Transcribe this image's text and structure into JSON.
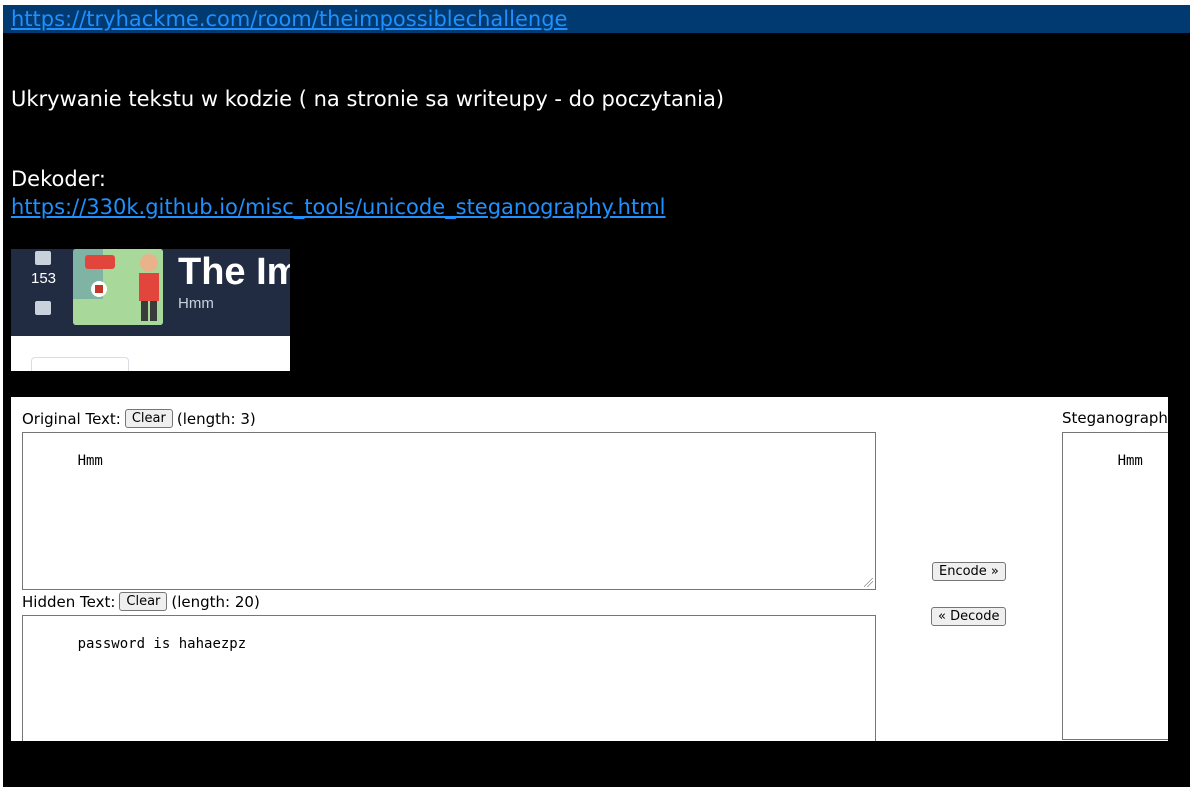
{
  "links": {
    "room_url": "https://tryhackme.com/room/theimpossiblechallenge",
    "decoder_url": "https://330k.github.io/misc_tools/unicode_steganography.html"
  },
  "notes": {
    "line1": "Ukrywanie tekstu w kodzie ( na stronie sa writeupy - do poczytania)",
    "decoder_label": "Dekoder:"
  },
  "room_card": {
    "vote_count": "153",
    "title": "The Im",
    "subtitle": "Hmm",
    "icons": [
      "thumbs-up-icon",
      "thumbs-down-icon"
    ]
  },
  "tool": {
    "original_label": "Original Text:",
    "original_clear": "Clear",
    "original_length": "(length: 3)",
    "original_value": "Hmm",
    "hidden_label": "Hidden Text:",
    "hidden_clear": "Clear",
    "hidden_length": "(length: 20)",
    "hidden_value": "password is hahaezpz",
    "encode_button": "Encode »",
    "decode_button": "« Decode",
    "stego_label": "Steganograph",
    "stego_value": "Hmm"
  },
  "colors": {
    "background": "#000000",
    "topbar": "#003a70",
    "link": "#1e90ff"
  }
}
